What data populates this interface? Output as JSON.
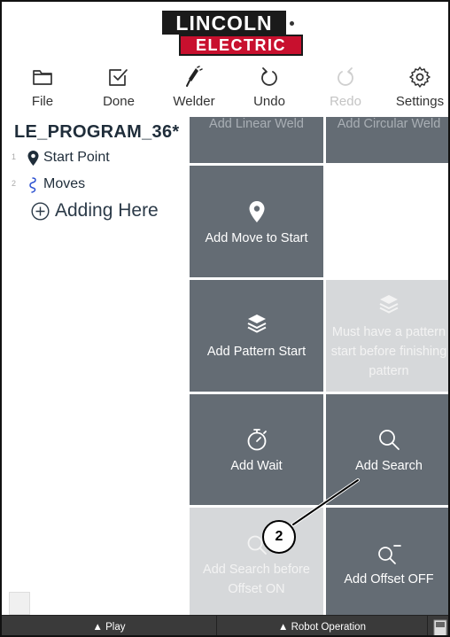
{
  "brand": {
    "top": "LINCOLN",
    "bottom": "ELECTRIC"
  },
  "toolbar": {
    "file": "File",
    "done": "Done",
    "welder": "Welder",
    "undo": "Undo",
    "redo": "Redo",
    "settings": "Settings"
  },
  "program": {
    "title": "LE_PROGRAM_36*",
    "items": [
      {
        "num": "1",
        "label": "Start Point",
        "icon": "location-pin-icon"
      },
      {
        "num": "2",
        "label": "Moves",
        "icon": "moves-path-icon"
      }
    ],
    "adding_here": "Adding Here"
  },
  "tiles": {
    "linear_weld": "Add Linear Weld",
    "circular_weld": "Add Circular Weld",
    "move_to_start": "Add Move to Start",
    "pattern_start": "Add Pattern Start",
    "pattern_disabled": "Must have a pattern start before finishing pattern",
    "wait": "Add Wait",
    "search": "Add Search",
    "search_disabled": "Add Search before Offset ON",
    "offset_off": "Add Offset OFF"
  },
  "callout": {
    "number": "2"
  },
  "bottombar": {
    "play": "▲ Play",
    "robot_operation": "▲ Robot Operation"
  },
  "colors": {
    "tile": "#646c74",
    "tile_disabled": "#d6d8da",
    "brand_red": "#c8102e",
    "bottombar": "#3a3a3a"
  }
}
